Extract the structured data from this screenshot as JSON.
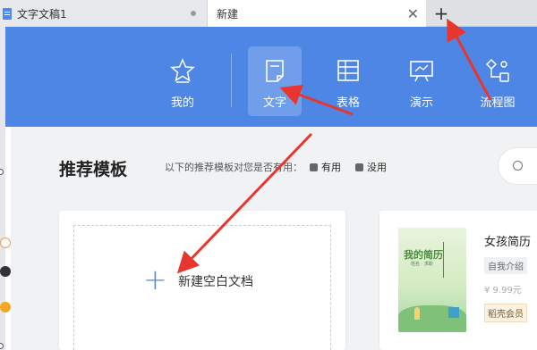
{
  "tabs": [
    {
      "label": "文字文稿1",
      "icon": "document-icon"
    },
    {
      "label": "新建",
      "icon": "close-icon"
    }
  ],
  "tab_add": "+",
  "nav": {
    "items": [
      {
        "label": "我的",
        "icon": "star-icon"
      },
      {
        "label": "文字",
        "icon": "document-icon"
      },
      {
        "label": "表格",
        "icon": "table-icon"
      },
      {
        "label": "演示",
        "icon": "presentation-icon"
      },
      {
        "label": "流程图",
        "icon": "flowchart-icon"
      }
    ],
    "active_index": 1
  },
  "section": {
    "title": "推荐模板",
    "subtitle": "以下的推荐模板对您是否有用：",
    "useful": "有用",
    "useless": "没用"
  },
  "new_blank": {
    "plus": "+",
    "label": "新建空白文档"
  },
  "template": {
    "title": "女孩简历",
    "tag": "自我介绍",
    "price": "¥ 9.99元",
    "vip": "稻壳会员",
    "image_title": "我的简历",
    "image_sub": "姓名 · 求职"
  },
  "colors": {
    "header_blue": "#4e86e5",
    "arrow_red": "#e8352e"
  }
}
